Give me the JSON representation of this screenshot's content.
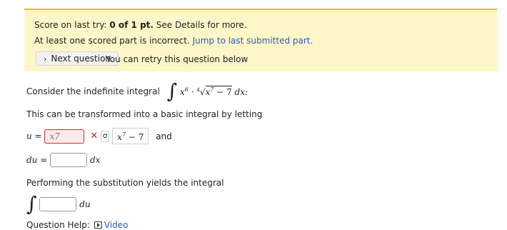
{
  "banner": {
    "score_prefix": "Score on last try: ",
    "score_value": "0 of 1 pt.",
    "score_suffix": " See Details for more.",
    "incorrect_text": "At least one scored part is incorrect. ",
    "jump_link": "Jump to last submitted part.",
    "next_button": "Next question",
    "retry_text": "You can retry this question below",
    "colors": {
      "background": "#fdf6c8",
      "accent": "#f2b43c",
      "link": "#2a5db8"
    }
  },
  "question": {
    "intro": "Consider the indefinite integral",
    "integrand": {
      "x_power_base": "x",
      "x_power_exp": "6",
      "dot": "·",
      "root_index": "4",
      "root_base": "x",
      "root_exp": "7",
      "root_tail": " − 7",
      "dx": "dx:"
    },
    "transform_text": "This can be transformed into a basic integral by letting",
    "u_label": "u =",
    "u_answer": "x7",
    "u_mark": "✕",
    "keypad_icon": "σ",
    "u_correct_base": "x",
    "u_correct_exp": "7",
    "u_correct_tail": " − 7",
    "and_text": "and",
    "du_label": "du =",
    "dx_label": "dx",
    "substitution_text": "Performing the substitution yields the integral",
    "du_tail": "du"
  },
  "help": {
    "label": "Question Help:",
    "video": "Video"
  }
}
